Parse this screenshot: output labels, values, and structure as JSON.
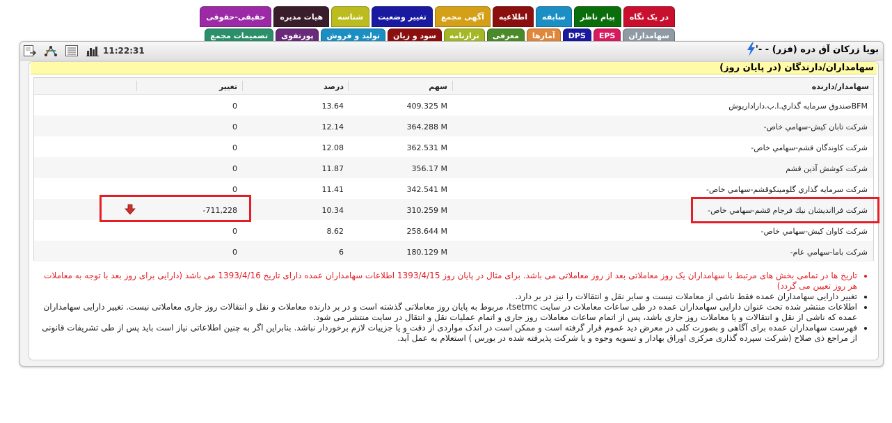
{
  "tabs": {
    "row1": [
      {
        "label": "در یک نگاه",
        "color": "#c8102e"
      },
      {
        "label": "پیام ناظر",
        "color": "#0a6e0a"
      },
      {
        "label": "سابقه",
        "color": "#1b8fc4"
      },
      {
        "label": "اطلاعیه",
        "color": "#8b0f0f"
      },
      {
        "label": "آگهی مجمع",
        "color": "#d4a017"
      },
      {
        "label": "تغییر وضعیت",
        "color": "#1a1aa0"
      },
      {
        "label": "شناسه",
        "color": "#bcbc1e"
      },
      {
        "label": "هیات مدیره",
        "color": "#3a1d2a"
      },
      {
        "label": "حقیقی-حقوقی",
        "color": "#9c2aa6"
      }
    ],
    "row2": [
      {
        "label": "سهامداران",
        "color": "#8f9aa3"
      },
      {
        "label": "EPS",
        "color": "#d81b60"
      },
      {
        "label": "DPS",
        "color": "#1a1aa0"
      },
      {
        "label": "آمارها",
        "color": "#e0873a"
      },
      {
        "label": "معرفی",
        "color": "#4a8a28"
      },
      {
        "label": "ترازنامه",
        "color": "#a3b824"
      },
      {
        "label": "سود و زیان",
        "color": "#8b0f0f"
      },
      {
        "label": "تولید و فروش",
        "color": "#1b8fc4"
      },
      {
        "label": "پورتفوی",
        "color": "#6a2a7a"
      },
      {
        "label": "تصمیمات مجمع",
        "color": "#2a8f6a"
      }
    ]
  },
  "header": {
    "company": "بویا زرکان آق دره (فزر) - -'",
    "time": "11:22:31"
  },
  "section_title": "سهامداران/دارندگان (در پایان روز)",
  "table": {
    "columns": {
      "holder": "سهامدار/دارنده",
      "shares": "سهم",
      "percent": "درصد",
      "change": "تغییر"
    },
    "rows": [
      {
        "holder": "BFMصندوق سرمايه گذاري.ا.ب.داراداریوش",
        "shares": "409.325 M",
        "percent": "13.64",
        "change": "0"
      },
      {
        "holder": "شركت تابان كيش-سهامي خاص-",
        "shares": "364.288 M",
        "percent": "12.14",
        "change": "0"
      },
      {
        "holder": "شركت كاوندگان قشم-سهامي خاص-",
        "shares": "362.531 M",
        "percent": "12.08",
        "change": "0"
      },
      {
        "holder": "شرکت کوشش آذین قشم",
        "shares": "356.17 M",
        "percent": "11.87",
        "change": "0"
      },
      {
        "holder": "شركت سرمايه گذاري گلومینکوقشم-سهامي خاص-",
        "shares": "342.541 M",
        "percent": "11.41",
        "change": "0"
      },
      {
        "holder": "شركت فراانديشان نيك فرجام قشم-سهامي خاص-",
        "shares": "310.259 M",
        "percent": "10.34",
        "change": "-711,228"
      },
      {
        "holder": "شركت كاوان كيش-سهامي خاص-",
        "shares": "258.644 M",
        "percent": "8.62",
        "change": "0"
      },
      {
        "holder": "شركت باما-سهامي عام-",
        "shares": "180.129 M",
        "percent": "6",
        "change": "0"
      }
    ]
  },
  "notes": [
    "تاریخ ها در تمامی بخش های مرتبط با سهامداران یک روز معاملاتی بعد از روز معاملاتی می باشد. برای مثال در پایان روز 1393/4/15 اطلاعات سهامداران عمده دارای تاریخ 1393/4/16 می باشد (دارایی برای روز بعد با توجه به معاملات هر روز تعیین می گردد)",
    "تغییر دارایی سهامداران عمده فقط ناشی از معاملات نیست و سایر نقل و انتقالات را نیز در بر دارد.",
    "اطلاعات منتشر شده تحت عنوان دارایی سهامداران عمده در طی ساعات معاملات در سایت tsetmc، مربوط به پایان روز معاملاتی گذشته است و در بر دارنده معاملات و نقل و انتقالات روز جاری معاملاتی نیست. تغییر دارایی سهامداران عمده که ناشی از نقل و انتقالات و یا معاملات روز جاری باشد، پس از اتمام ساعات معاملات روز جاری و اتمام عملیات نقل و انتقال در سایت منتشر می شود.",
    "فهرست سهامداران عمده برای آگاهی و بصورت کلی در معرض دید عموم قرار گرفته است و ممکن است در اندک مواردی از دقت و یا جزییات لازم برخوردار نباشد. بنابراین اگر به چنین اطلاعاتی نیاز است باید پس از طی تشریفات قانونی از مراجع ذی صلاح (شرکت سپرده گذاری مرکزی اوراق بهادار و تسویه وجوه و یا شرکت پذیرفته شده در بورس ) استعلام به عمل آید."
  ],
  "colors": {
    "highlight": "#e31e24",
    "section_bg": "#fffba6",
    "down_arrow": "#d32f2f"
  }
}
